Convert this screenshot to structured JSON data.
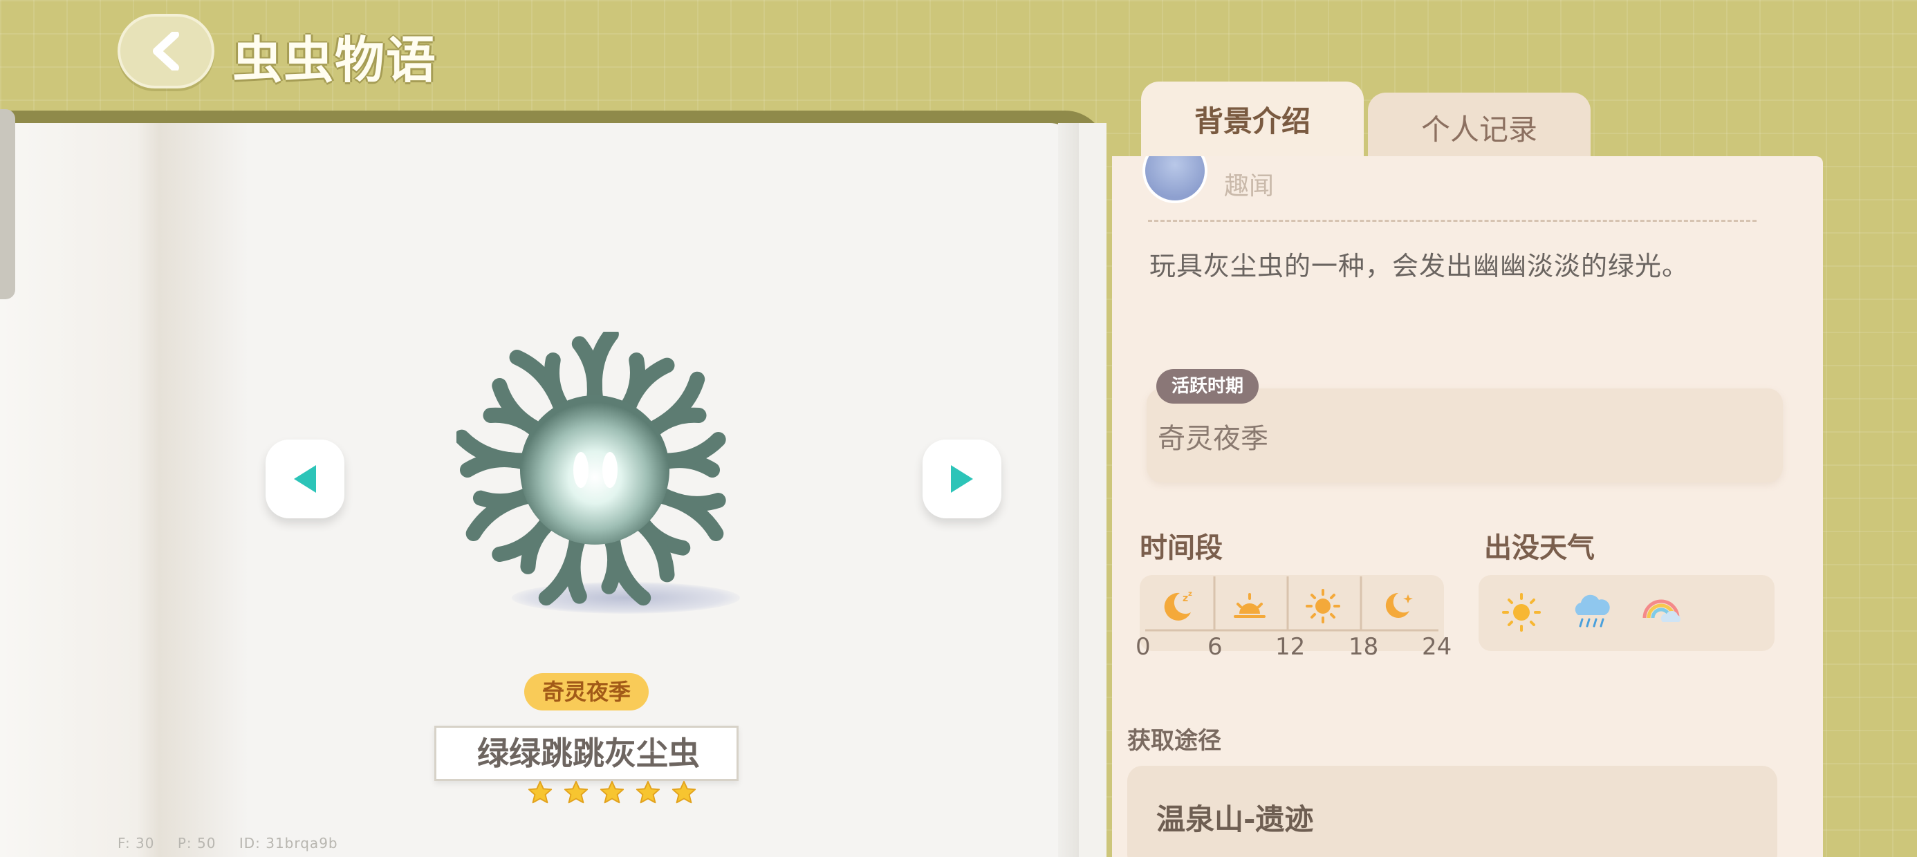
{
  "header": {
    "title": "虫虫物语",
    "back_icon": "chevron-left-icon"
  },
  "tabs": [
    {
      "label": "背景介绍",
      "active": true
    },
    {
      "label": "个人记录",
      "active": false
    }
  ],
  "bug": {
    "name": "绿绿跳跳灰尘虫",
    "season_badge": "奇灵夜季",
    "rarity_stars": 5,
    "description": "玩具灰尘虫的一种，会发出幽幽淡淡的绿光。"
  },
  "author": {
    "name": "趣闻"
  },
  "active_period": {
    "label": "活跃时期",
    "value": "奇灵夜季"
  },
  "time_period": {
    "label": "时间段",
    "icons": [
      "sleeping-moon-icon",
      "sunrise-icon",
      "sun-icon",
      "moon-star-icon"
    ],
    "ticks": [
      "0",
      "6",
      "12",
      "18",
      "24"
    ]
  },
  "weather": {
    "label": "出没天气",
    "icons": [
      "sunny-icon",
      "rain-icon",
      "rainbow-icon"
    ]
  },
  "obtain": {
    "label": "获取途径",
    "value": "温泉山-遗迹"
  },
  "debug": {
    "f": "F: 30",
    "p": "P: 50",
    "id": "ID: 31brqa9b"
  },
  "colors": {
    "accent_teal": "#2cc4b8",
    "star_gold": "#f7c530",
    "badge_yellow": "#f9cb58",
    "background_olive": "#cdc67a"
  }
}
